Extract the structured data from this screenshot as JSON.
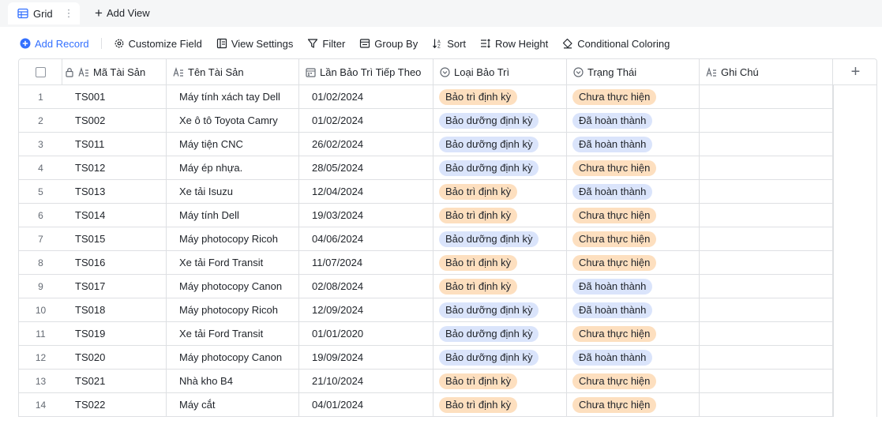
{
  "view_tabs": {
    "active_label": "Grid",
    "more": "⋮",
    "add_view_label": "Add View"
  },
  "toolbar": {
    "add_record": "Add Record",
    "customize_field": "Customize Field",
    "view_settings": "View Settings",
    "filter": "Filter",
    "group_by": "Group By",
    "sort": "Sort",
    "row_height": "Row Height",
    "conditional_coloring": "Conditional Coloring"
  },
  "columns": [
    "Mã Tài Sản",
    "Tên Tài Sản",
    "Lần Bảo Trì Tiếp Theo",
    "Loại Bảo Trì",
    "Trạng Thái",
    "Ghi Chú"
  ],
  "add_column": "+",
  "colors": {
    "accent": "#3370ff",
    "tag_orange": "#fddfbf",
    "tag_blue": "#dae4fb",
    "border": "#dee0e3"
  },
  "rows": [
    {
      "num": "1",
      "code": "TS001",
      "name": "Máy tính xách tay Dell",
      "date": "01/02/2024",
      "type": "Bảo trì định kỳ",
      "type_color": "orange",
      "status": "Chưa thực hiện",
      "status_color": "orange",
      "note": ""
    },
    {
      "num": "2",
      "code": "TS002",
      "name": "Xe ô tô Toyota Camry",
      "date": "01/02/2024",
      "type": "Bảo dưỡng định kỳ",
      "type_color": "blue",
      "status": "Đã hoàn thành",
      "status_color": "blue",
      "note": ""
    },
    {
      "num": "3",
      "code": "TS011",
      "name": "Máy tiện CNC",
      "date": "26/02/2024",
      "type": "Bảo dưỡng định kỳ",
      "type_color": "blue",
      "status": "Đã hoàn thành",
      "status_color": "blue",
      "note": ""
    },
    {
      "num": "4",
      "code": "TS012",
      "name": "Máy ép nhựa.",
      "date": "28/05/2024",
      "type": "Bảo dưỡng định kỳ",
      "type_color": "blue",
      "status": "Chưa thực hiện",
      "status_color": "orange",
      "note": ""
    },
    {
      "num": "5",
      "code": "TS013",
      "name": "Xe tải Isuzu",
      "date": "12/04/2024",
      "type": "Bảo trì định kỳ",
      "type_color": "orange",
      "status": "Đã hoàn thành",
      "status_color": "blue",
      "note": ""
    },
    {
      "num": "6",
      "code": "TS014",
      "name": "Máy tính Dell",
      "date": "19/03/2024",
      "type": "Bảo trì định kỳ",
      "type_color": "orange",
      "status": "Chưa thực hiện",
      "status_color": "orange",
      "note": ""
    },
    {
      "num": "7",
      "code": "TS015",
      "name": "Máy photocopy Ricoh",
      "date": "04/06/2024",
      "type": "Bảo dưỡng định kỳ",
      "type_color": "blue",
      "status": "Chưa thực hiện",
      "status_color": "orange",
      "note": ""
    },
    {
      "num": "8",
      "code": "TS016",
      "name": "Xe tải Ford Transit",
      "date": "11/07/2024",
      "type": "Bảo trì định kỳ",
      "type_color": "orange",
      "status": "Chưa thực hiện",
      "status_color": "orange",
      "note": ""
    },
    {
      "num": "9",
      "code": "TS017",
      "name": "Máy photocopy Canon",
      "date": "02/08/2024",
      "type": "Bảo trì định kỳ",
      "type_color": "orange",
      "status": "Đã hoàn thành",
      "status_color": "blue",
      "note": ""
    },
    {
      "num": "10",
      "code": "TS018",
      "name": "Máy photocopy Ricoh",
      "date": "12/09/2024",
      "type": "Bảo dưỡng định kỳ",
      "type_color": "blue",
      "status": "Đã hoàn thành",
      "status_color": "blue",
      "note": ""
    },
    {
      "num": "11",
      "code": "TS019",
      "name": "Xe tải Ford Transit",
      "date": "01/01/2020",
      "type": "Bảo dưỡng định kỳ",
      "type_color": "blue",
      "status": "Chưa thực hiện",
      "status_color": "orange",
      "note": ""
    },
    {
      "num": "12",
      "code": "TS020",
      "name": "Máy photocopy Canon",
      "date": "19/09/2024",
      "type": "Bảo dưỡng định kỳ",
      "type_color": "blue",
      "status": "Đã hoàn thành",
      "status_color": "blue",
      "note": ""
    },
    {
      "num": "13",
      "code": "TS021",
      "name": "Nhà kho B4",
      "date": "21/10/2024",
      "type": "Bảo trì định kỳ",
      "type_color": "orange",
      "status": "Chưa thực hiện",
      "status_color": "orange",
      "note": ""
    },
    {
      "num": "14",
      "code": "TS022",
      "name": "Máy cắt",
      "date": "04/01/2024",
      "type": "Bảo trì định kỳ",
      "type_color": "orange",
      "status": "Chưa thực hiện",
      "status_color": "orange",
      "note": ""
    }
  ]
}
